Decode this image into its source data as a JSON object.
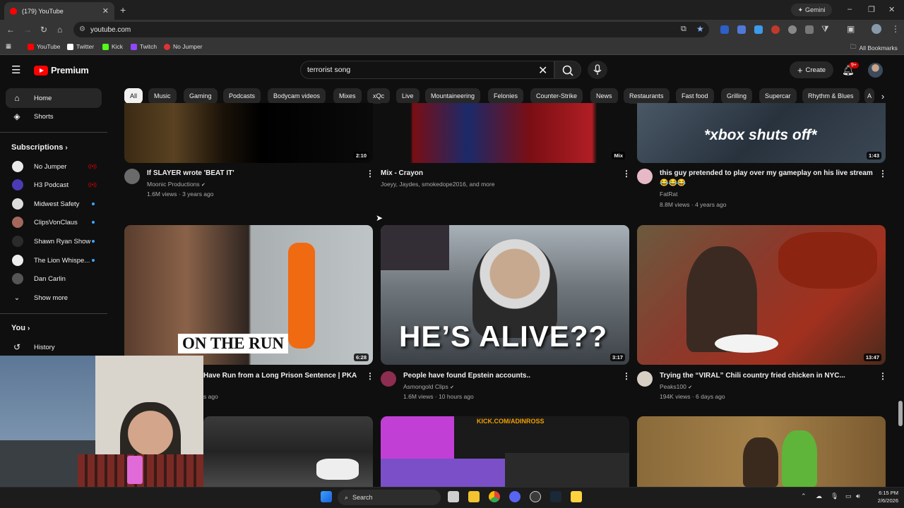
{
  "browser": {
    "tab_title": "(179) YouTube",
    "url": "youtube.com",
    "gemini_label": "Gemini",
    "bookmarks": [
      "YouTube",
      "Twitter",
      "Kick",
      "Twitch",
      "No Jumper"
    ],
    "all_bookmarks": "All Bookmarks"
  },
  "header": {
    "logo": "Premium",
    "search_value": "terrorist song",
    "create_label": "Create",
    "notif_count": "9+"
  },
  "sidebar": {
    "home": "Home",
    "shorts": "Shorts",
    "subscriptions_heading": "Subscriptions",
    "subscriptions": [
      "No Jumper",
      "H3 Podcast",
      "Midwest Safety",
      "ClipsVonClaus",
      "Shawn Ryan Show",
      "The Lion Whispe...",
      "Dan Carlin"
    ],
    "show_more": "Show more",
    "you_heading": "You",
    "history": "History"
  },
  "chips": [
    "All",
    "Music",
    "Gaming",
    "Podcasts",
    "Bodycam videos",
    "Mixes",
    "xQc",
    "Live",
    "Mountaineering",
    "Felonies",
    "Counter-Strike",
    "News",
    "Restaurants",
    "Fast food",
    "Grilling",
    "Supercar",
    "Rhythm & Blues",
    "A"
  ],
  "videos": [
    {
      "title": "If SLAYER wrote 'BEAT IT'",
      "channel": "Moonic Productions",
      "meta": "1.6M views · 3 years ago",
      "duration": "2:10"
    },
    {
      "title": "Mix - Crayon",
      "channel": "Joeyy, Jaydes, smokedope2016, and more",
      "meta": "",
      "duration": "Mix"
    },
    {
      "title": "this guy pretended to play over my gameplay on his live stream",
      "title2": "😂😂😂",
      "channel": "FatRat",
      "meta": "8.8M views · 4 years ago",
      "duration": "1:43",
      "overlay": "*xbox shuts off*"
    },
    {
      "title": "Have Run from a Long Prison Sentence | PKA",
      "channel": "",
      "meta": "s ago",
      "duration": "6:28",
      "overlay": "ON THE RUN"
    },
    {
      "title": "People have found Epstein accounts..",
      "channel": "Asmongold Clips",
      "meta": "1.6M views · 10 hours ago",
      "duration": "3:17",
      "overlay": "HE’S ALIVE??"
    },
    {
      "title": "Trying the “VIRAL” Chili country fried chicken in NYC...",
      "channel": "Peaks100",
      "meta": "194K views · 6 days ago",
      "duration": "13:47"
    },
    {
      "overlay": "KICK.COM/ADINROSS"
    }
  ],
  "taskbar": {
    "search_label": "Search",
    "time": "6:15 PM",
    "date": "2/6/2026"
  }
}
